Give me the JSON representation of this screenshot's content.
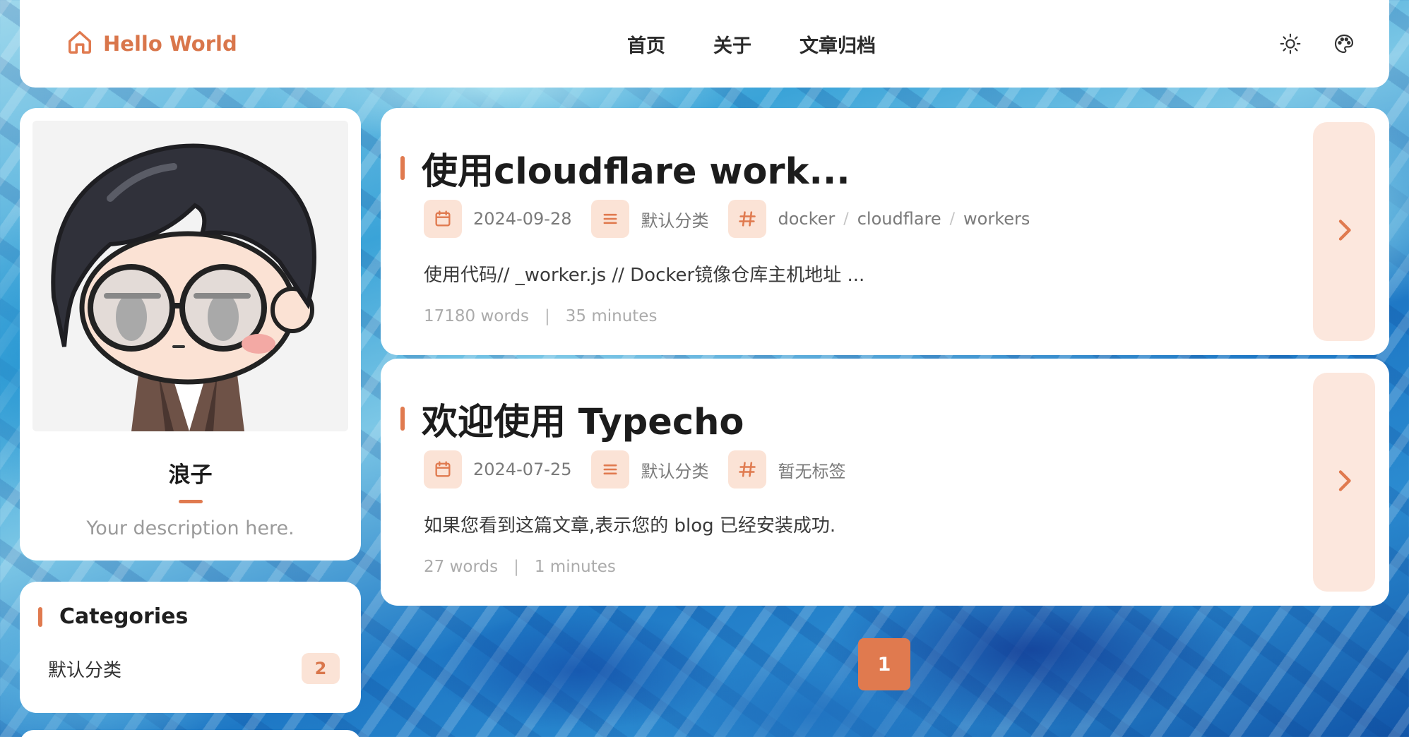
{
  "header": {
    "brand": "Hello World",
    "nav": [
      "首页",
      "关于",
      "文章归档"
    ],
    "icons": [
      "home-icon",
      "sun-icon",
      "palette-icon"
    ]
  },
  "profile": {
    "name": "浪子",
    "description": "Your description here."
  },
  "categories": {
    "title": "Categories",
    "items": [
      {
        "name": "默认分类",
        "count": "2"
      }
    ]
  },
  "posts": [
    {
      "title": "使用cloudflare work...",
      "date": "2024-09-28",
      "category": "默认分类",
      "tags": [
        "docker",
        "cloudflare",
        "workers"
      ],
      "excerpt": "使用代码// _worker.js // Docker镜像仓库主机地址 ...",
      "words": "17180 words",
      "time": "35 minutes"
    },
    {
      "title": "欢迎使用 Typecho",
      "date": "2024-07-25",
      "category": "默认分类",
      "tags": [
        "暂无标签"
      ],
      "excerpt": "如果您看到这篇文章,表示您的 blog 已经安装成功.",
      "words": "27 words",
      "time": "1 minutes"
    }
  ],
  "pagination": {
    "current": "1"
  },
  "colors": {
    "accent": "#e07a4f",
    "accent_light": "#fbe3d6"
  }
}
